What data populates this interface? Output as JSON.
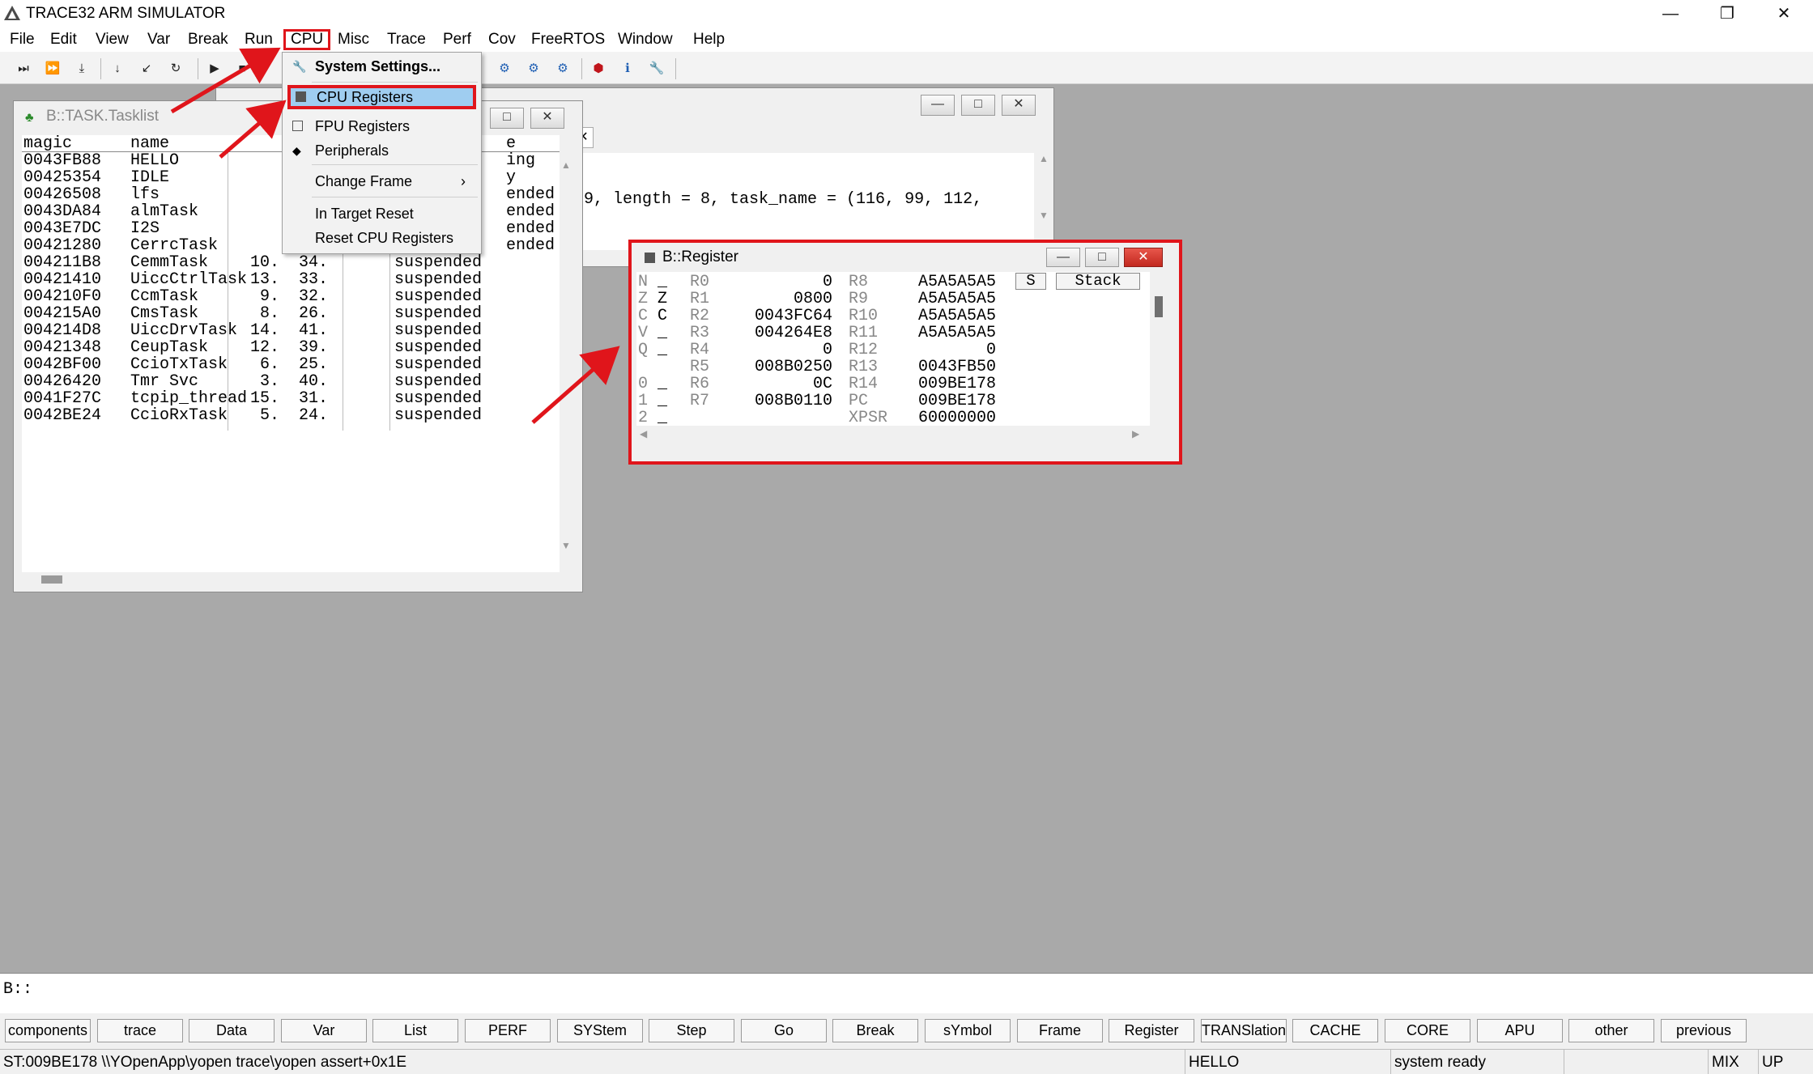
{
  "app": {
    "title": "TRACE32 ARM SIMULATOR"
  },
  "window_controls": {
    "minimize": "—",
    "restore": "❐",
    "close": "✕"
  },
  "menubar": [
    "File",
    "Edit",
    "View",
    "Var",
    "Break",
    "Run",
    "CPU",
    "Misc",
    "Trace",
    "Perf",
    "Cov",
    "FreeRTOS",
    "Window",
    "Help"
  ],
  "cpu_menu": {
    "items": [
      {
        "label": "System Settings...",
        "icon": "wrench-icon",
        "bold": true
      },
      {
        "label": "CPU Registers",
        "icon": "register-icon",
        "highlighted": true
      },
      {
        "label": "FPU Registers",
        "icon": "fpu-icon"
      },
      {
        "label": "Peripherals",
        "icon": "peripherals-icon"
      },
      {
        "label": "Change Frame",
        "icon": "",
        "submenu_arrow": "›"
      },
      {
        "label": "In Target Reset",
        "icon": ""
      },
      {
        "label": "Reset CPU Registers",
        "icon": ""
      }
    ]
  },
  "tasklist": {
    "title": "B::TASK.Tasklist",
    "headers": {
      "magic": "magic",
      "name": "name",
      "state_fragment": "e"
    },
    "rows": [
      {
        "magic": "0043FB88",
        "name": "HELLO",
        "prio": "",
        "tcb": "",
        "state": "ing"
      },
      {
        "magic": "00425354",
        "name": "IDLE",
        "prio": "",
        "tcb": "",
        "state": "y"
      },
      {
        "magic": "00426508",
        "name": "lfs",
        "prio": "",
        "tcb": "",
        "state": "ended"
      },
      {
        "magic": "0043DA84",
        "name": "almTask",
        "prio": "",
        "tcb": "",
        "state": "ended"
      },
      {
        "magic": "0043E7DC",
        "name": "I2S",
        "prio": "",
        "tcb": "",
        "state": "ended"
      },
      {
        "magic": "00421280",
        "name": "CerrcTask",
        "prio": "",
        "tcb": "",
        "state": "ended"
      },
      {
        "magic": "004211B8",
        "name": "CemmTask",
        "prio": "10.",
        "tcb": "34.",
        "state": "suspended"
      },
      {
        "magic": "00421410",
        "name": "UiccCtrlTask",
        "prio": "13.",
        "tcb": "33.",
        "state": "suspended"
      },
      {
        "magic": "004210F0",
        "name": "CcmTask",
        "prio": "9.",
        "tcb": "32.",
        "state": "suspended"
      },
      {
        "magic": "004215A0",
        "name": "CmsTask",
        "prio": "8.",
        "tcb": "26.",
        "state": "suspended"
      },
      {
        "magic": "004214D8",
        "name": "UiccDrvTask",
        "prio": "14.",
        "tcb": "41.",
        "state": "suspended"
      },
      {
        "magic": "00421348",
        "name": "CeupTask",
        "prio": "12.",
        "tcb": "39.",
        "state": "suspended"
      },
      {
        "magic": "0042BF00",
        "name": "CcioTxTask",
        "prio": "6.",
        "tcb": "25.",
        "state": "suspended"
      },
      {
        "magic": "00426420",
        "name": "Tmr Svc",
        "prio": "3.",
        "tcb": "40.",
        "state": "suspended"
      },
      {
        "magic": "0041F27C",
        "name": "tcpip_thread",
        "prio": "15.",
        "tcb": "31.",
        "state": "suspended"
      },
      {
        "magic": "0042BE24",
        "name": "CcioRxTask",
        "prio": "5.",
        "tcb": "24.",
        "state": "suspended"
      }
    ]
  },
  "back_window": {
    "tab_close": "✕",
    "text": "9, length = 8, task_name = (116, 99, 112,"
  },
  "register": {
    "title": "B::Register",
    "flags": [
      {
        "flag": "N",
        "val": "_"
      },
      {
        "flag": "Z",
        "val": "Z"
      },
      {
        "flag": "C",
        "val": "C"
      },
      {
        "flag": "V",
        "val": "_"
      },
      {
        "flag": "Q",
        "val": "_"
      },
      {
        "flag": "",
        "val": ""
      },
      {
        "flag": "0",
        "val": "_"
      },
      {
        "flag": "1",
        "val": "_"
      },
      {
        "flag": "2",
        "val": "_"
      }
    ],
    "left_regs": [
      {
        "name": "R0",
        "value": "0"
      },
      {
        "name": "R1",
        "value": "0800"
      },
      {
        "name": "R2",
        "value": "0043FC64"
      },
      {
        "name": "R3",
        "value": "004264E8"
      },
      {
        "name": "R4",
        "value": "0"
      },
      {
        "name": "R5",
        "value": "008B0250"
      },
      {
        "name": "R6",
        "value": "0C"
      },
      {
        "name": "R7",
        "value": "008B0110"
      }
    ],
    "right_regs": [
      {
        "name": "R8",
        "value": "A5A5A5A5"
      },
      {
        "name": "R9",
        "value": "A5A5A5A5"
      },
      {
        "name": "R10",
        "value": "A5A5A5A5"
      },
      {
        "name": "R11",
        "value": "A5A5A5A5"
      },
      {
        "name": "R12",
        "value": "0"
      },
      {
        "name": "R13",
        "value": "0043FB50"
      },
      {
        "name": "R14",
        "value": "009BE178"
      },
      {
        "name": "PC",
        "value": "009BE178"
      },
      {
        "name": "XPSR",
        "value": "60000000"
      }
    ],
    "s_button": "S",
    "stack_button": "Stack"
  },
  "command": {
    "prompt": "B::",
    "value": ""
  },
  "softkeys": [
    "components",
    "trace",
    "Data",
    "Var",
    "List",
    "PERF",
    "SYStem",
    "Step",
    "Go",
    "Break",
    "sYmbol",
    "Frame",
    "Register",
    "TRANSlation",
    "CACHE",
    "CORE",
    "APU",
    "other",
    "previous"
  ],
  "status": {
    "location": "ST:009BE178  \\\\YOpenApp\\yopen trace\\yopen assert+0x1E",
    "task": "HELLO",
    "state": "system ready",
    "mode": "MIX",
    "dir": "UP"
  },
  "colors": {
    "annotation_red": "#e0151b",
    "highlight_blue": "#9fcdf0",
    "mdi_gray": "#a9a9a9"
  }
}
